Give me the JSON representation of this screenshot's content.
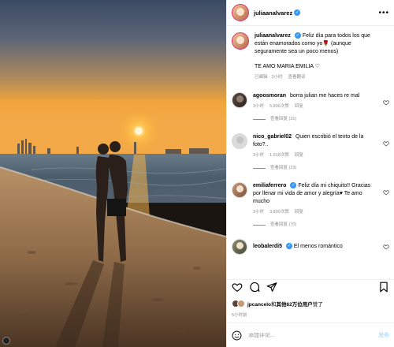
{
  "post": {
    "username": "juliaanalvarez",
    "caption_text": "Feliz día para todos los que están enamorados como yo🌹 (aunque seguramente sea un poco menos)",
    "caption_line2": "TE AMO MARIA EMILIA ♡",
    "caption_time": "已编辑 · 3小时",
    "see_translation": "查看翻译",
    "more_label": "•••"
  },
  "comments": [
    {
      "user": "agoosmoran",
      "text": "borra julian me haces re mal",
      "time": "3小时",
      "likes": "5,806次赞",
      "reply": "回复",
      "replies": "查看回复 (31)",
      "avatar": "dark"
    },
    {
      "user": "nico_gabriel02",
      "text": "Quien escribió el texto de la foto?..",
      "time": "3小时",
      "likes": "1,918次赞",
      "reply": "回复",
      "replies": "查看回复 (23)",
      "avatar": "gray"
    },
    {
      "user": "emiliaferrero",
      "text": "Feliz día mi chiquito!! Gracias por llenar mi vida de amor y alegría♥ Te amo mucho",
      "time": "3小时",
      "likes": "3,800次赞",
      "reply": "回复",
      "replies": "查看回复 (70)",
      "avatar": "brown"
    },
    {
      "user": "leobalerdi5",
      "text": "El menos romántico",
      "avatar": "olive"
    }
  ],
  "likes": {
    "prefix": "jpcancelo",
    "mid": "和",
    "others": "其他62万位用户",
    "suffix": "赞了"
  },
  "time_ago": "5小时前",
  "add_comment": {
    "placeholder": "添加评论...",
    "post_label": "发布"
  },
  "colors": {
    "accent": "#3897f0",
    "sky_top": "#3b4a63",
    "sun": "#ffb02e",
    "sand": "#a27c56"
  },
  "icons": [
    "heart-icon",
    "comment-icon",
    "share-icon",
    "bookmark-icon",
    "emoji-icon",
    "verified-icon"
  ]
}
